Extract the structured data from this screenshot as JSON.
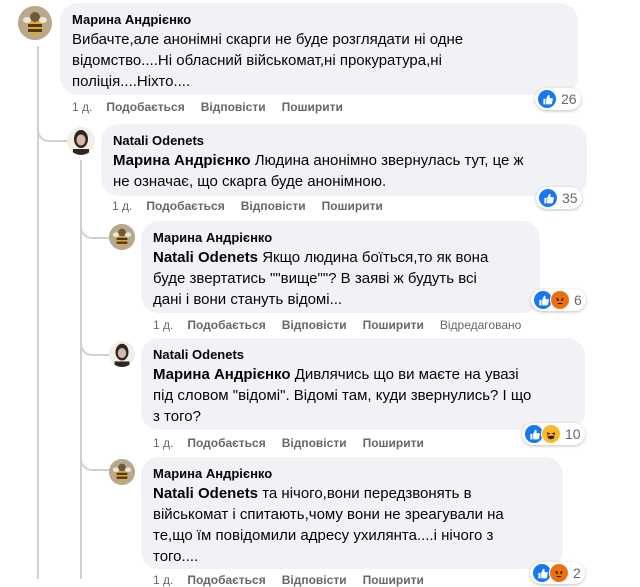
{
  "colors": {
    "bubble_bg": "#f0f2f5",
    "meta_text": "#65676b",
    "like_blue": "#1877f2",
    "emoji_yellow": "#f7b928"
  },
  "comments": [
    {
      "author": "Марина Андрієнко",
      "mention": "",
      "text_lines": [
        "Вибачте,але анонімні скарги не буде розглядати ні одне",
        "відомство....Ні обласний військомат,ні прокуратура,ні",
        "поліція....Ніхто...."
      ],
      "time": "1 д.",
      "like": "Подобається",
      "reply": "Відповісти",
      "share": "Поширити",
      "edited": "",
      "reaction_icons": [
        "like-icon"
      ],
      "reaction_count": "26"
    },
    {
      "author": "Natali Odenets",
      "mention": "Марина Андрієнко",
      "text_lines": [
        " Людина анонімно звернулась тут, це ж",
        "не означає, що скарга буде анонімною."
      ],
      "time": "1 д.",
      "like": "Подобається",
      "reply": "Відповісти",
      "share": "Поширити",
      "edited": "",
      "reaction_icons": [
        "like-icon"
      ],
      "reaction_count": "35"
    },
    {
      "author": "Марина Андрієнко",
      "mention": "Natali Odenets",
      "text_lines": [
        " Якщо людина боїться,то як вона",
        "буде звертатись \"\"вище\"\"? В заяві ж будуть всі",
        "дані і вони стануть відомі..."
      ],
      "time": "1 д.",
      "like": "Подобається",
      "reply": "Відповісти",
      "share": "Поширити",
      "edited": "Відредаговано",
      "reaction_icons": [
        "like-icon",
        "angry-icon"
      ],
      "reaction_count": "6"
    },
    {
      "author": "Natali Odenets",
      "mention": "Марина Андрієнко",
      "text_lines": [
        " Дивлячись що ви маєте на увазі",
        "під словом \"відомі\". Відомі там, куди звернулись? І що",
        "з того?"
      ],
      "time": "1 д.",
      "like": "Подобається",
      "reply": "Відповісти",
      "share": "Поширити",
      "edited": "",
      "reaction_icons": [
        "like-icon",
        "haha-icon"
      ],
      "reaction_count": "10"
    },
    {
      "author": "Марина Андрієнко",
      "mention": "Natali Odenets",
      "text_lines": [
        " та нічого,вони передзвонять в",
        "військомат і спитають,чому вони не зреагували на",
        "те,що їм повідомили адресу ухилянта....і нічого з",
        "того...."
      ],
      "time": "1 д.",
      "like": "Подобається",
      "reply": "Відповісти",
      "share": "Поширити",
      "edited": "",
      "reaction_icons": [
        "like-icon",
        "angry-icon"
      ],
      "reaction_count": "2"
    }
  ]
}
